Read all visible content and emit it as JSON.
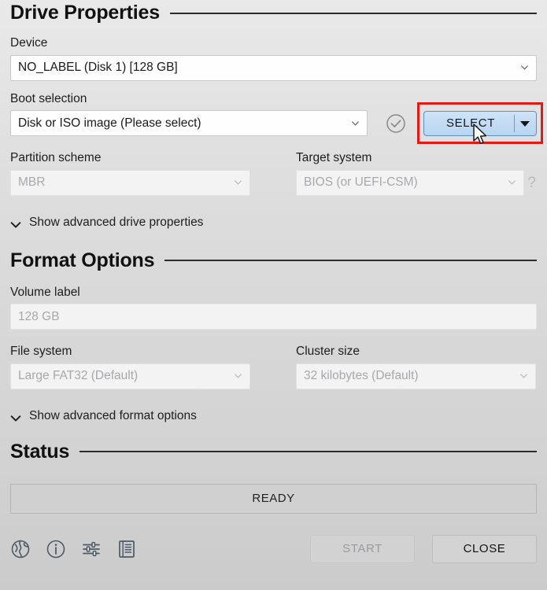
{
  "drive_properties": {
    "heading": "Drive Properties",
    "device": {
      "label": "Device",
      "value": "NO_LABEL (Disk 1) [128 GB]"
    },
    "boot_selection": {
      "label": "Boot selection",
      "value": "Disk or ISO image (Please select)",
      "status_icon": "check-circle-icon",
      "select_button": "SELECT",
      "select_dropdown_icon": "caret-down-icon",
      "highlight_color": "#e01b17",
      "button_color": "#c3dcf3"
    },
    "partition_scheme": {
      "label": "Partition scheme",
      "value": "MBR"
    },
    "target_system": {
      "label": "Target system",
      "value": "BIOS (or UEFI-CSM)",
      "help": "?"
    },
    "advanced_toggle": "Show advanced drive properties"
  },
  "format_options": {
    "heading": "Format Options",
    "volume_label": {
      "label": "Volume label",
      "value": "128 GB"
    },
    "file_system": {
      "label": "File system",
      "value": "Large FAT32 (Default)"
    },
    "cluster_size": {
      "label": "Cluster size",
      "value": "32 kilobytes (Default)"
    },
    "advanced_toggle": "Show advanced format options"
  },
  "status": {
    "heading": "Status",
    "message": "READY"
  },
  "bottom_bar": {
    "icons": [
      {
        "name": "globe-language-icon"
      },
      {
        "name": "info-icon"
      },
      {
        "name": "settings-sliders-icon"
      },
      {
        "name": "log-list-icon"
      }
    ],
    "start_button": "START",
    "close_button": "CLOSE"
  }
}
